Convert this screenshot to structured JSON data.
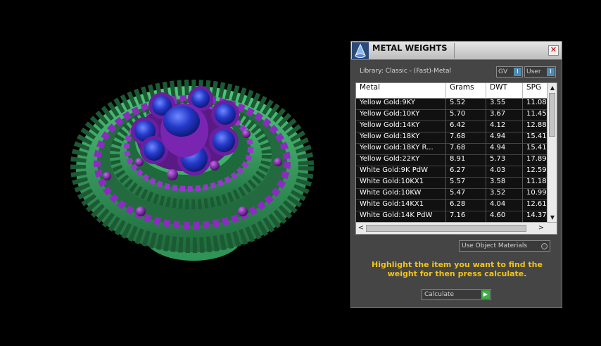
{
  "window": {
    "title": "METAL WEIGHTS",
    "close_symbol": "✕"
  },
  "library": {
    "label": "Library: Classic - (Fast)-Metal",
    "gv_label": "GV",
    "user_label": "User",
    "indicator_symbol": "I"
  },
  "table": {
    "headers": [
      "Metal",
      "Grams",
      "DWT",
      "SPG"
    ],
    "rows": [
      [
        "Yellow Gold:9KY",
        "5.52",
        "3.55",
        "11.08"
      ],
      [
        "Yellow Gold:10KY",
        "5.70",
        "3.67",
        "11.45"
      ],
      [
        "Yellow Gold:14KY",
        "6.42",
        "4.12",
        "12.88"
      ],
      [
        "Yellow Gold:18KY",
        "7.68",
        "4.94",
        "15.41"
      ],
      [
        "Yellow Gold:18KY R...",
        "7.68",
        "4.94",
        "15.41"
      ],
      [
        "Yellow Gold:22KY",
        "8.91",
        "5.73",
        "17.89"
      ],
      [
        "White Gold:9K PdW",
        "6.27",
        "4.03",
        "12.59"
      ],
      [
        "White Gold:10KX1",
        "5.57",
        "3.58",
        "11.18"
      ],
      [
        "White Gold:10KW",
        "5.47",
        "3.52",
        "10.99"
      ],
      [
        "White Gold:14KX1",
        "6.28",
        "4.04",
        "12.61"
      ],
      [
        "White Gold:14K PdW",
        "7.16",
        "4.60",
        "14.37"
      ]
    ],
    "scroll_up": "▲",
    "scroll_down": "▼",
    "scroll_left": "<",
    "scroll_right": ">"
  },
  "use_object_materials": "Use Object Materials",
  "instruction": "Highlight the item you want to find the weight for then press calculate.",
  "calculate": {
    "label": "Calculate",
    "arrow": "▶"
  },
  "colors": {
    "instruction_text": "#f2c417",
    "ring_green": "#3fae67",
    "bead_purple": "#7a1fa8",
    "gem_blue": "#2a45d6"
  },
  "icons": {
    "title_icon": "matrix-cone-icon",
    "close_icon": "close-icon",
    "calculate_icon": "play-arrow-icon"
  }
}
